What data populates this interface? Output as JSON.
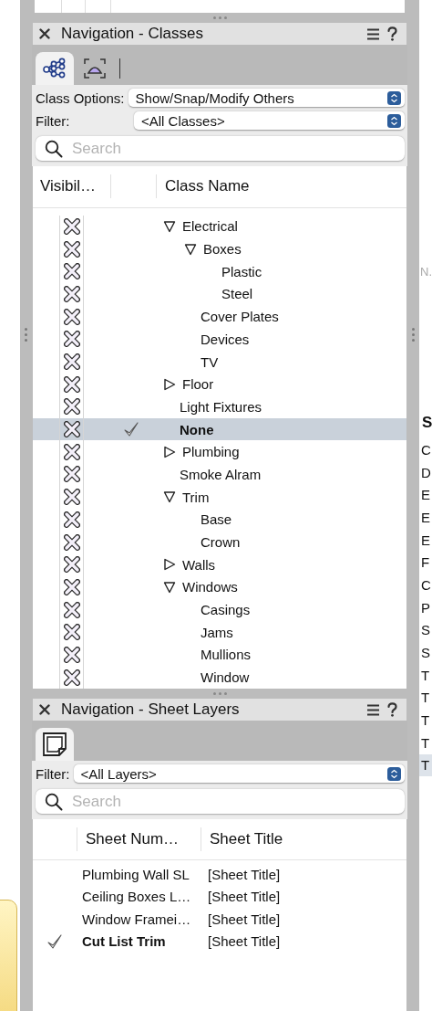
{
  "classes_palette": {
    "title": "Navigation - Classes",
    "tabs": [
      {
        "kind": "tree",
        "selected": true
      },
      {
        "kind": "frame",
        "selected": false
      }
    ],
    "class_options": {
      "label": "Class Options:",
      "value": "Show/Snap/Modify Others"
    },
    "filter": {
      "label": "Filter:",
      "value": "<All Classes>"
    },
    "search": {
      "placeholder": "Search"
    },
    "columns": [
      "Visibil…",
      "Class Name"
    ],
    "rows": [
      {
        "name": "Electrical",
        "expanded": true,
        "selected": false,
        "children": [
          {
            "name": "Boxes",
            "expanded": true,
            "selected": false,
            "children": [
              {
                "name": "Plastic",
                "selected": false
              },
              {
                "name": "Steel",
                "selected": false
              }
            ]
          },
          {
            "name": "Cover Plates",
            "selected": false
          },
          {
            "name": "Devices",
            "selected": false
          },
          {
            "name": "TV",
            "selected": false
          }
        ]
      },
      {
        "name": "Floor",
        "expanded": false,
        "selected": false
      },
      {
        "name": "Light Fixtures",
        "selected": false
      },
      {
        "name": "None",
        "selected": true
      },
      {
        "name": "Plumbing",
        "expanded": false,
        "selected": false
      },
      {
        "name": "Smoke Alram",
        "selected": false
      },
      {
        "name": "Trim",
        "expanded": true,
        "selected": false,
        "children": [
          {
            "name": "Base",
            "selected": false
          },
          {
            "name": "Crown",
            "selected": false
          }
        ]
      },
      {
        "name": "Walls",
        "expanded": false,
        "selected": false
      },
      {
        "name": "Windows",
        "expanded": true,
        "selected": false,
        "children": [
          {
            "name": "Casings",
            "selected": false
          },
          {
            "name": "Jams",
            "selected": false
          },
          {
            "name": "Mullions",
            "selected": false
          },
          {
            "name": "Window",
            "selected": false
          }
        ]
      }
    ]
  },
  "sheet_layers_palette": {
    "title": "Navigation - Sheet Layers",
    "tabs": [
      {
        "kind": "sheet",
        "selected": true
      }
    ],
    "filter": {
      "label": "Filter:",
      "value": "<All Layers>"
    },
    "search": {
      "placeholder": "Search"
    },
    "columns": [
      "Sheet Num…",
      "Sheet Title"
    ],
    "rows": [
      {
        "number": "Plumbing Wall SL",
        "title": "[Sheet Title]",
        "selected": false
      },
      {
        "number": "Ceiling Boxes L…",
        "title": "[Sheet Title]",
        "selected": false
      },
      {
        "number": "Window Framei…",
        "title": "[Sheet Title]",
        "selected": false
      },
      {
        "number": "Cut List Trim",
        "title": "[Sheet Title]",
        "selected": true
      }
    ]
  },
  "side_panel": {
    "hint": "N.",
    "header": "S",
    "rows": [
      {
        "label": "C",
        "selected": false
      },
      {
        "label": "D",
        "selected": false
      },
      {
        "label": "E",
        "selected": false
      },
      {
        "label": "E",
        "selected": false
      },
      {
        "label": "E",
        "selected": false
      },
      {
        "label": "F",
        "selected": false
      },
      {
        "label": "C",
        "selected": false
      },
      {
        "label": "P",
        "selected": false
      },
      {
        "label": "S",
        "selected": false
      },
      {
        "label": "S",
        "selected": false
      },
      {
        "label": "T",
        "selected": false
      },
      {
        "label": "T",
        "selected": false
      },
      {
        "label": "T",
        "selected": false
      },
      {
        "label": "T",
        "selected": false
      },
      {
        "label": "T",
        "selected": true
      }
    ]
  }
}
